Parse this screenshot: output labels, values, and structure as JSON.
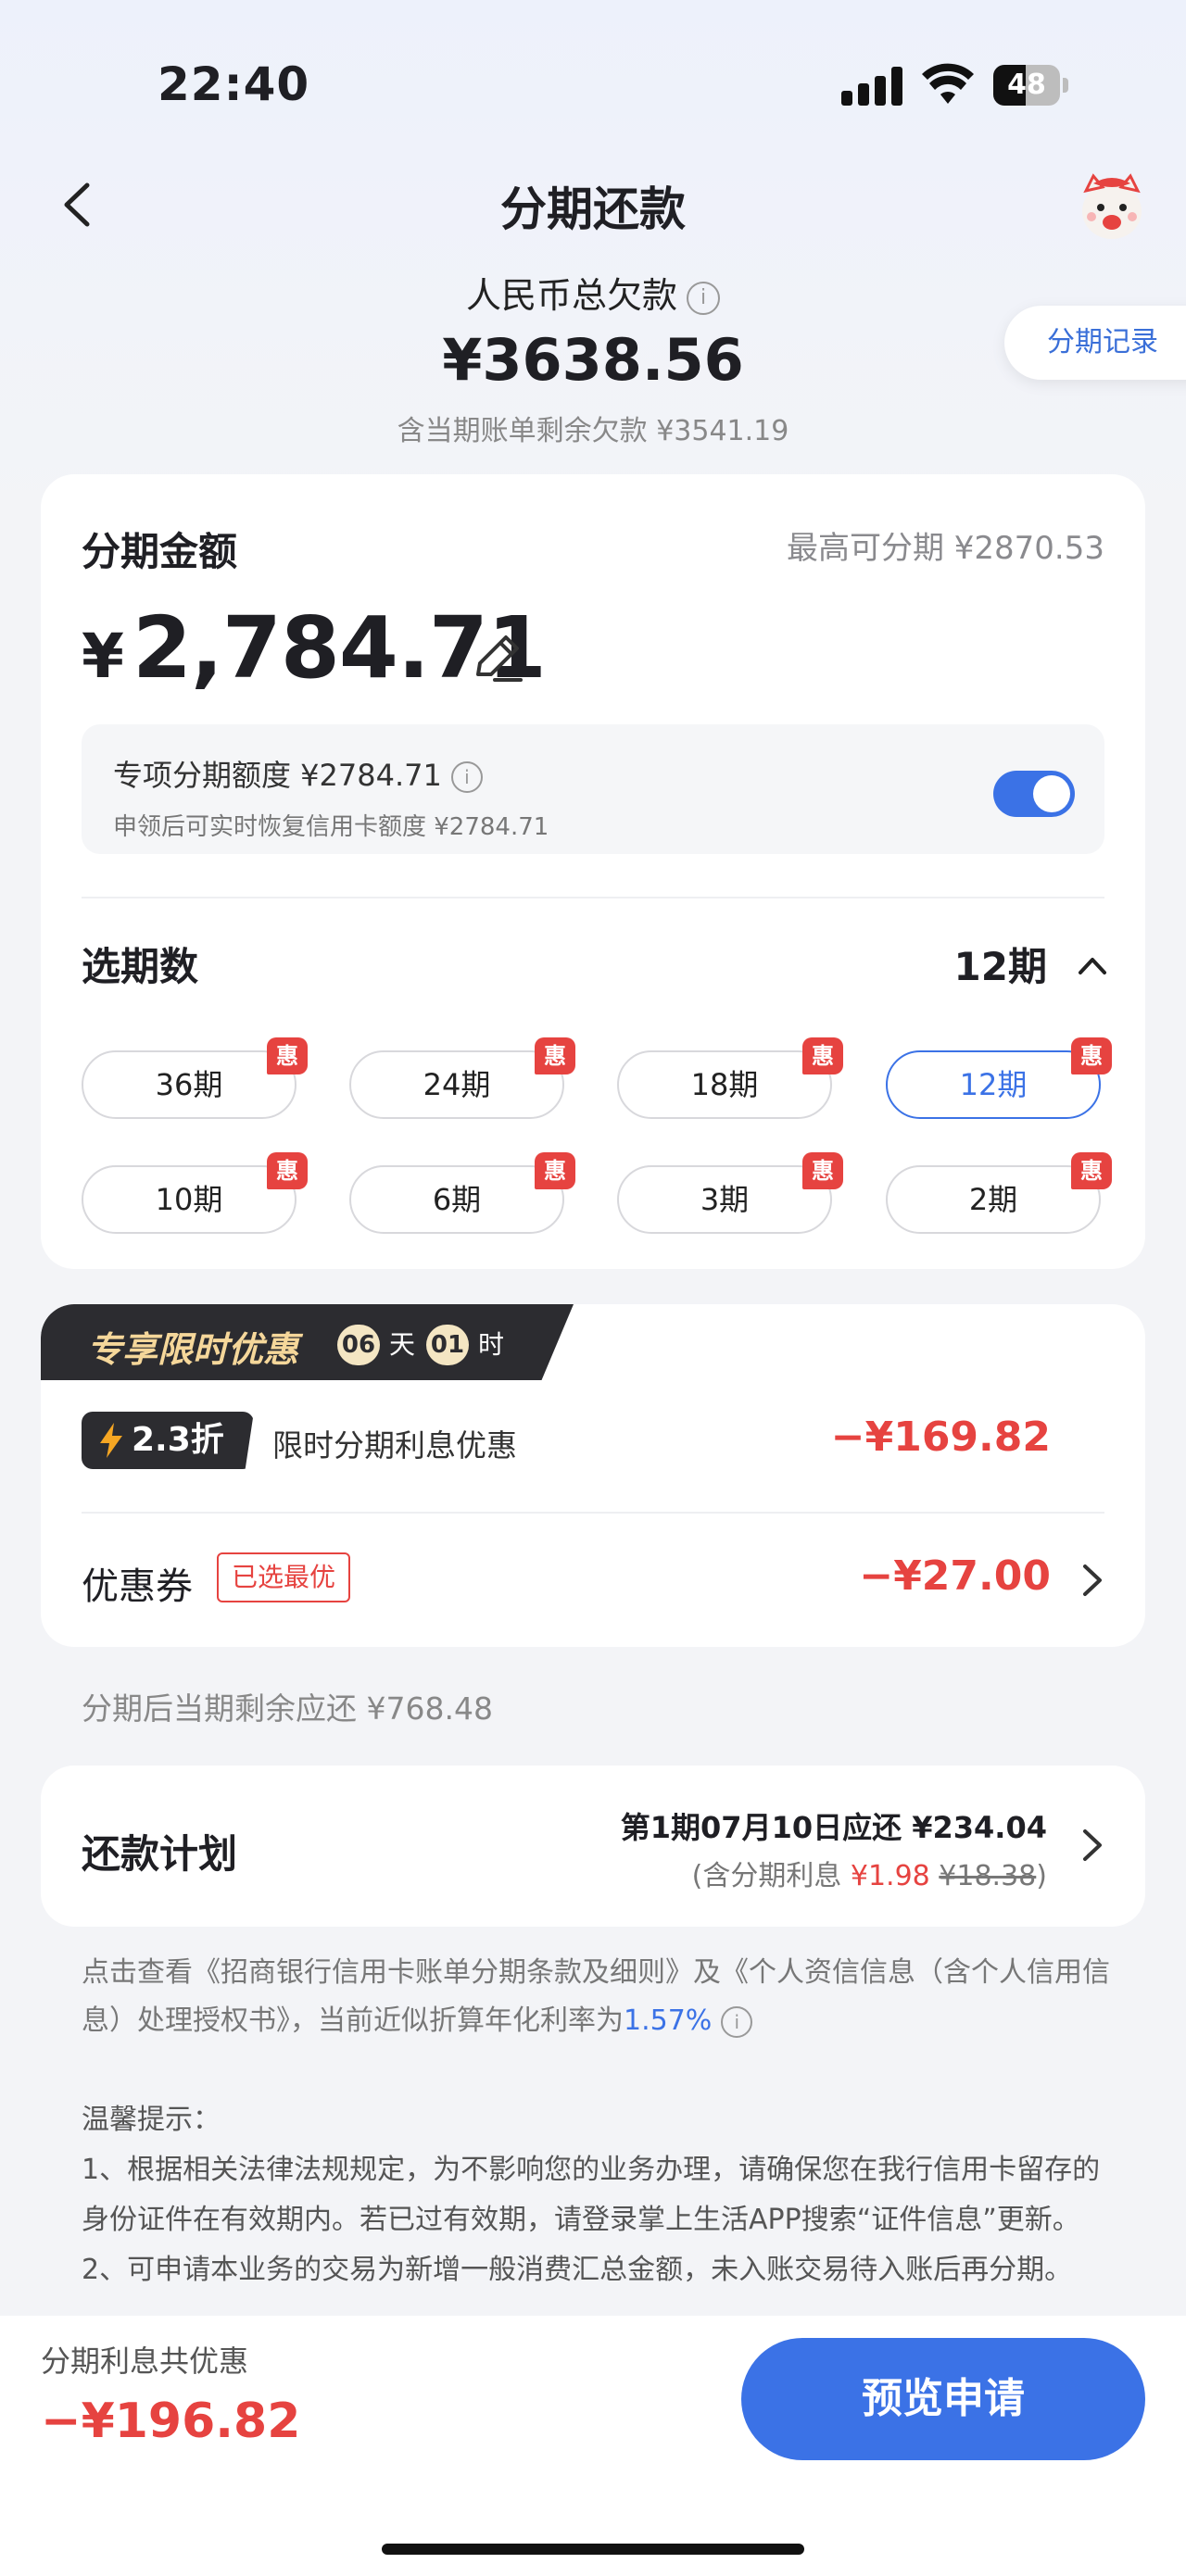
{
  "status_bar": {
    "time": "22:40",
    "battery": "48",
    "battery_level": 0.48
  },
  "nav": {
    "title": "分期还款"
  },
  "summary": {
    "label": "人民币总欠款",
    "total": "¥3638.56",
    "subtotal": "含当期账单剩余欠款 ¥3541.19",
    "record_button": "分期记录"
  },
  "amount_card": {
    "label": "分期金额",
    "max": "最高可分期 ¥2870.53",
    "currency": "¥",
    "amount": "2,784.71",
    "quota_title": "专项分期额度 ¥2784.71",
    "quota_desc": "申领后可实时恢复信用卡额度 ¥2784.71",
    "quota_toggle_on": true,
    "term_label": "选期数",
    "term_selected": "12期",
    "terms": [
      {
        "label": "36期",
        "badge": "惠"
      },
      {
        "label": "24期",
        "badge": "惠"
      },
      {
        "label": "18期",
        "badge": "惠"
      },
      {
        "label": "12期",
        "badge": "惠",
        "selected": true
      },
      {
        "label": "10期",
        "badge": "惠"
      },
      {
        "label": "6期",
        "badge": "惠"
      },
      {
        "label": "3期",
        "badge": "惠"
      },
      {
        "label": "2期",
        "badge": "惠"
      }
    ]
  },
  "promo": {
    "title": "专享限时优惠",
    "countdown_days": "06",
    "countdown_day_unit": "天",
    "countdown_hours": "01",
    "countdown_hour_unit": "时",
    "discount_badge": "2.3折",
    "discount_desc": "限时分期利息优惠",
    "discount_amount": "−¥169.82",
    "coupon_label": "优惠券",
    "coupon_tag": "已选最优",
    "coupon_amount": "−¥27.00"
  },
  "remaining": "分期后当期剩余应还 ¥768.48",
  "plan": {
    "label": "还款计划",
    "line1": "第1期07月10日应还 ¥234.04",
    "line2_prefix": "(含分期利息 ",
    "interest_now": "¥1.98",
    "interest_orig": "¥18.38",
    "line2_suffix": ")"
  },
  "terms_text": {
    "part1": "点击查看《招商银行信用卡账单分期条款及细则》及《个人资信信息（含个人信用信息）处理授权书》，当前近似折算年化利率为",
    "rate": "1.57%"
  },
  "tips": {
    "title": "温馨提示：",
    "item1": "1、根据相关法律法规规定，为不影响您的业务办理，请确保您在我行信用卡留存的身份证件在有效期内。若已过有效期，请登录掌上生活APP搜索“证件信息”更新。",
    "item2": "2、可申请本业务的交易为新增一般消费汇总金额，未入账交易待入账后再分期。"
  },
  "bottom": {
    "label": "分期利息共优惠",
    "amount": "−¥196.82",
    "button": "预览申请"
  },
  "colors": {
    "accent": "#3b72e6",
    "discount_red": "#e64340",
    "promo_dark": "#2c2c30",
    "promo_gold": "#f5d79a"
  }
}
